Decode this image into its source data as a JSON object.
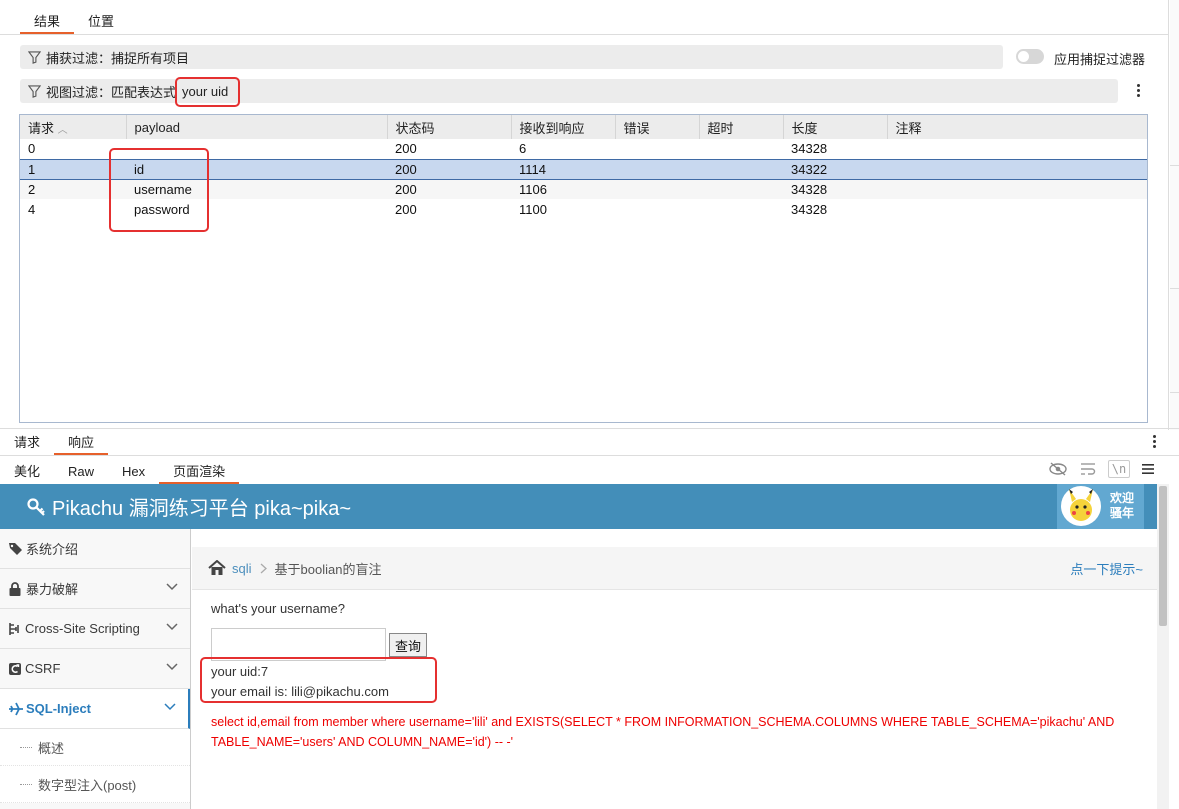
{
  "top_tabs": [
    "结果",
    "位置"
  ],
  "capture_filter": {
    "label": "捕获过滤：捕捉所有项目",
    "toggle_label": "应用捕捉过滤器"
  },
  "view_filter": {
    "label": "视图过滤：匹配表达式",
    "value": "your uid"
  },
  "table": {
    "columns": [
      "请求",
      "payload",
      "状态码",
      "接收到响应",
      "错误",
      "超时",
      "长度",
      "注释"
    ],
    "rows": [
      [
        "0",
        "",
        "200",
        "6",
        "",
        "",
        "34328",
        ""
      ],
      [
        "1",
        "id",
        "200",
        "1114",
        "",
        "",
        "34322",
        ""
      ],
      [
        "2",
        "username",
        "200",
        "1106",
        "",
        "",
        "34328",
        ""
      ],
      [
        "4",
        "password",
        "200",
        "1100",
        "",
        "",
        "34328",
        ""
      ]
    ],
    "selected_index": 1
  },
  "reqresp_tabs": [
    "请求",
    "响应"
  ],
  "view_tabs": [
    "美化",
    "Raw",
    "Hex",
    "页面渲染"
  ],
  "newline_label": "\\n",
  "rendered": {
    "site_title": "Pikachu 漏洞练习平台 pika~pika~",
    "welcome": [
      "欢迎",
      "骚年"
    ],
    "sidebar": [
      {
        "label": "系统介绍",
        "icon": "tag-icon"
      },
      {
        "label": "暴力破解",
        "icon": "lock-icon"
      },
      {
        "label": "Cross-Site Scripting",
        "icon": "xss-icon"
      },
      {
        "label": "CSRF",
        "icon": "csrf-icon"
      },
      {
        "label": "SQL-Inject",
        "icon": "plane-icon"
      }
    ],
    "subitems": [
      "概述",
      "数字型注入(post)"
    ],
    "breadcrumb": {
      "section": "sqli",
      "current": "基于boolian的盲注",
      "hint": "点一下提示~"
    },
    "form_label": "what's your username?",
    "query_button": "查询",
    "result_uid": "your uid:7",
    "result_email": "your email is: lili@pikachu.com",
    "sql": "select id,email from member where username='lili' and EXISTS(SELECT * FROM INFORMATION_SCHEMA.COLUMNS WHERE TABLE_SCHEMA='pikachu' AND TABLE_NAME='users' AND COLUMN_NAME='id') -- -'"
  },
  "colors": {
    "accent": "#e6602b",
    "header": "#438eb9",
    "highlight": "#e53030",
    "selected_row": "#c8d8ef"
  }
}
